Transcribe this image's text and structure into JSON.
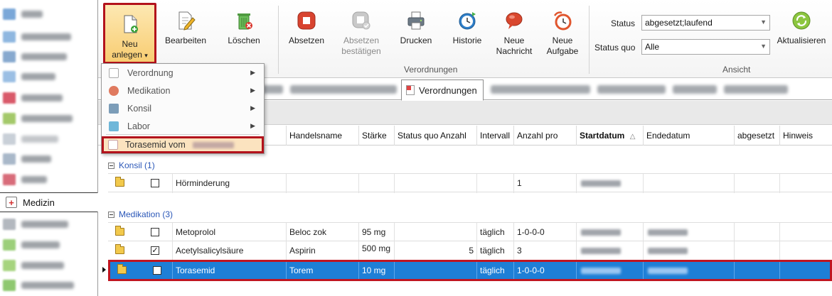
{
  "nav": {
    "selected_label": "Medizin"
  },
  "ribbon": {
    "neu_anlegen": {
      "line1": "Neu",
      "line2": "anlegen",
      "arrow": "▾"
    },
    "bearbeiten": "Bearbeiten",
    "loeschen": "Löschen",
    "absetzen": "Absetzen",
    "absetzen_bestaetigen": {
      "line1": "Absetzen",
      "line2": "bestätigen"
    },
    "drucken": "Drucken",
    "historie": "Historie",
    "neue_nachricht": {
      "line1": "Neue",
      "line2": "Nachricht"
    },
    "neue_aufgabe": {
      "line1": "Neue",
      "line2": "Aufgabe"
    },
    "group_verordnungen": "Verordnungen",
    "group_ansicht": "Ansicht",
    "status_label": "Status",
    "status_value": "abgesetzt;laufend",
    "status_quo_label": "Status quo",
    "status_quo_value": "Alle",
    "aktualisieren": "Aktualisieren"
  },
  "menu": {
    "items": [
      {
        "label": "Verordnung",
        "arrow": "▶"
      },
      {
        "label": "Medikation",
        "arrow": "▶"
      },
      {
        "label": "Konsil",
        "arrow": "▶"
      },
      {
        "label": "Labor",
        "arrow": "▶"
      }
    ],
    "torasemid": "Torasemid vom"
  },
  "tabs": {
    "active": "Verordnungen"
  },
  "grid": {
    "columns": [
      "Handelsname",
      "Stärke",
      "Status quo Anzahl",
      "Intervall",
      "Anzahl pro",
      "Startdatum",
      "Endedatum",
      "abgesetzt",
      "Hinweis"
    ],
    "sort_indicator": "△",
    "groups": [
      {
        "title": "Konsil (1)",
        "rows": [
          {
            "checked": false,
            "name": "Hörminderung",
            "handelsname": "",
            "staerke": "",
            "sq_anzahl": "",
            "intervall": "",
            "anzahl_pro": "1"
          }
        ]
      },
      {
        "title": "Medikation (3)",
        "rows": [
          {
            "checked": false,
            "name": "Metoprolol",
            "handelsname": "Beloc zok",
            "staerke": "95 mg",
            "sq_anzahl": "",
            "intervall": "täglich",
            "anzahl_pro": "1-0-0-0"
          },
          {
            "checked": true,
            "name": "Acetylsalicylsäure",
            "handelsname": "Aspirin",
            "staerke": "500 mg",
            "sq_anzahl": "5",
            "intervall": "täglich",
            "anzahl_pro": "3"
          },
          {
            "checked": false,
            "name": "Torasemid",
            "handelsname": "Torem",
            "staerke": "10 mg",
            "sq_anzahl": "",
            "intervall": "täglich",
            "anzahl_pro": "1-0-0-0",
            "selected": true
          }
        ]
      }
    ]
  },
  "colors": {
    "highlight_red": "#b3121c",
    "selection_blue": "#1e7fd6",
    "group_blue": "#2a57b8",
    "button_active": "#f8cd72"
  },
  "icons": {
    "neu": "new-document-icon",
    "bearbeiten": "edit-icon",
    "loeschen": "trash-icon",
    "absetzen": "stop-icon",
    "drucken": "printer-icon",
    "historie": "history-clock-icon",
    "nachricht": "message-icon",
    "aufgabe": "task-clock-icon",
    "aktualisieren": "refresh-icon"
  }
}
